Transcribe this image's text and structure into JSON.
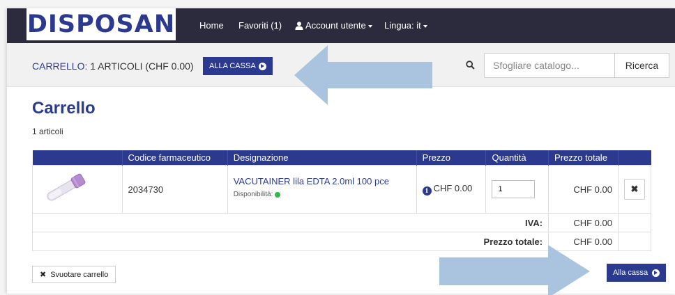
{
  "brand": {
    "logo_text": "DISPOSAN"
  },
  "nav": {
    "home": "Home",
    "favorites": "Favoriti (1)",
    "account": "Account utente",
    "language": "Lingua: it"
  },
  "cart_bar": {
    "label": "CARRELLO:",
    "summary": "1 ARTICOLI (CHF 0.00)",
    "checkout_label": "ALLA CASSA"
  },
  "search": {
    "placeholder": "Sfogliare catalogo...",
    "button_label": "Ricerca"
  },
  "main": {
    "title": "Carrello",
    "item_count": "1 articoli"
  },
  "table": {
    "headers": [
      "",
      "Codice farmaceutico",
      "Designazione",
      "Prezzo",
      "Quantità",
      "Prezzo totale",
      ""
    ],
    "rows": [
      {
        "code": "2034730",
        "designation": "VACUTAINER lila EDTA 2.0ml 100 pce",
        "availability_label": "Disponibilità:",
        "availability_status": "available",
        "price": "CHF 0.00",
        "quantity": "1",
        "total": "CHF 0.00",
        "remove_symbol": "✖"
      }
    ],
    "summary": [
      {
        "label": "IVA:",
        "value": "CHF 0.00"
      },
      {
        "label": "Prezzo totale:",
        "value": "CHF 0.00"
      }
    ]
  },
  "actions": {
    "empty_cart": "Svuotare carrello",
    "empty_symbol": "✖",
    "checkout": "Alla cassa"
  },
  "colors": {
    "navbar": "#2b2b3d",
    "accent": "#2b3a8f",
    "available": "#2fb84a",
    "arrow_overlay": "#aac4e0"
  }
}
